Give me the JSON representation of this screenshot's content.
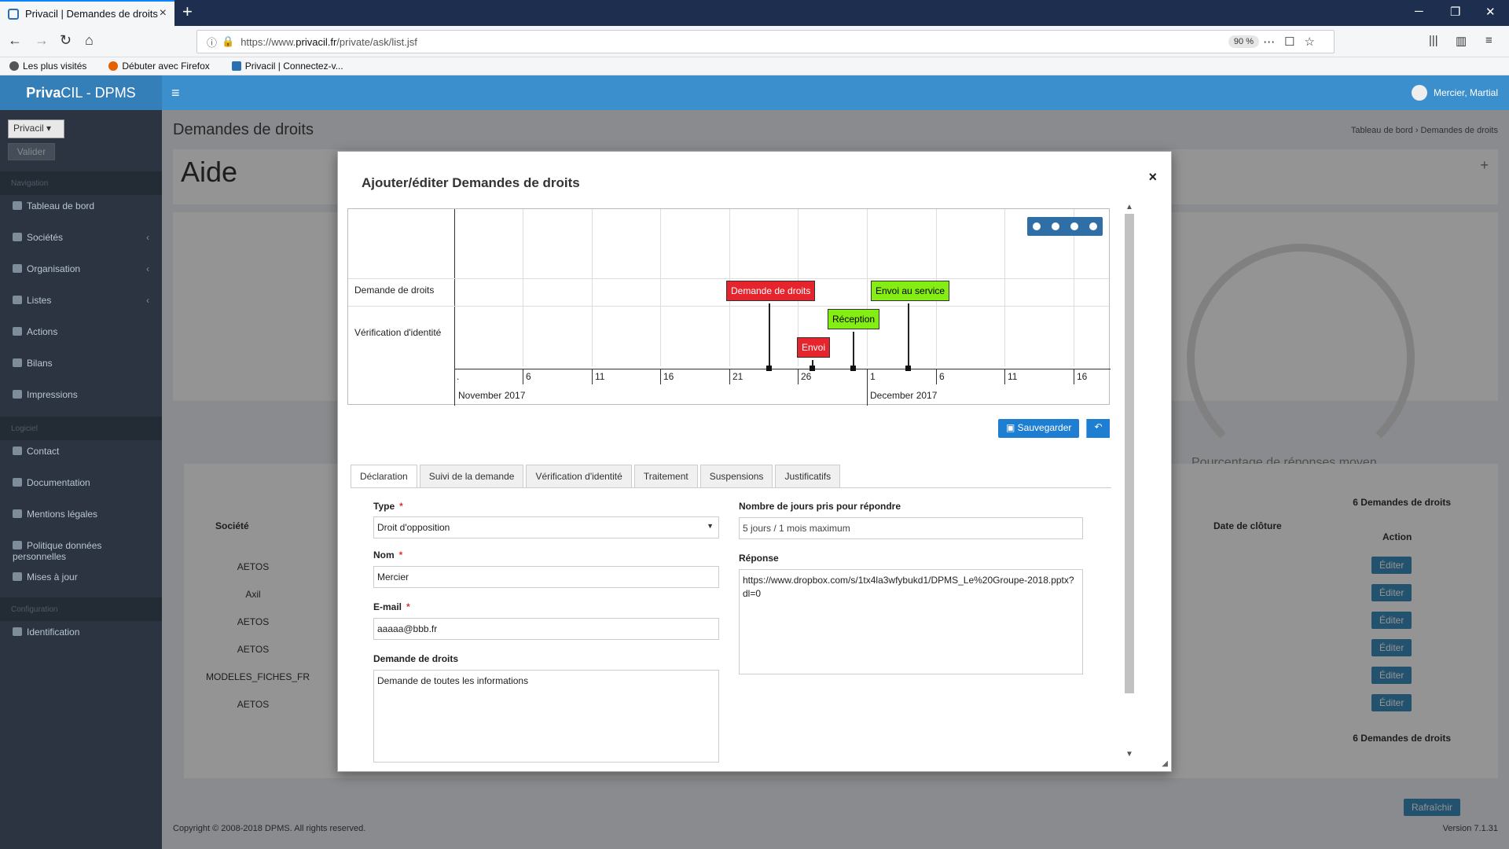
{
  "browser": {
    "tab_title": "Privacil | Demandes de droits",
    "url_prefix": "https://www.",
    "url_domain": "privacil.fr",
    "url_path": "/private/ask/list.jsf",
    "zoom": "90 %",
    "bookmarks": [
      "Les plus visités",
      "Débuter avec Firefox",
      "Privacil | Connectez-v..."
    ]
  },
  "app": {
    "brand_bold": "Priva",
    "brand_rest": "CIL - DPMS",
    "user_name": "Mercier, Martial"
  },
  "sidebar": {
    "select_value": "Privacil",
    "validate_label": "Valider",
    "heading_navigation": "Navigation",
    "heading_logiciel": "Logiciel",
    "heading_configuration": "Configuration",
    "items": [
      {
        "label": "Tableau de bord"
      },
      {
        "label": "Sociétés"
      },
      {
        "label": "Organisation"
      },
      {
        "label": "Listes"
      },
      {
        "label": "Actions"
      },
      {
        "label": "Bilans"
      },
      {
        "label": "Impressions"
      },
      {
        "label": "Contact"
      },
      {
        "label": "Documentation"
      },
      {
        "label": "Mentions légales"
      },
      {
        "label": "Politique données personnelles"
      },
      {
        "label": "Mises à jour"
      },
      {
        "label": "Identification"
      }
    ]
  },
  "page": {
    "title": "Demandes de droits",
    "crumb": "Tableau de bord  ›  Demandes de droits",
    "aide": "Aide",
    "gauge_label": "Pourcentage de réponses moyen",
    "refresh_label": "Rafraîchir",
    "count_label": "6 Demandes de droits",
    "col_societe": "Société",
    "col_cloture": "Date de clôture",
    "col_action": "Action",
    "edit_label": "Éditer",
    "rows": [
      "AETOS",
      "Axil",
      "AETOS",
      "AETOS",
      "MODELES_FICHES_FR",
      "AETOS"
    ],
    "footer": "Copyright © 2008-2018 DPMS. All rights reserved.",
    "version": "Version 7.1.31"
  },
  "modal": {
    "title": "Ajouter/éditer Demandes de droits",
    "close": "×",
    "timeline": {
      "rows": [
        "Demande de droits",
        "Vérification d'identité"
      ],
      "ticks": [
        ".",
        "6",
        "11",
        "16",
        "21",
        "26",
        "1",
        "6",
        "11",
        "16"
      ],
      "months": [
        "November 2017",
        "December 2017"
      ],
      "events": [
        {
          "label": "Demande de droits",
          "color": "#e6242e"
        },
        {
          "label": "Envoi au service",
          "color": "#84ee14"
        },
        {
          "label": "Réception",
          "color": "#84ee14"
        },
        {
          "label": "Envoi",
          "color": "#e6242e"
        }
      ]
    },
    "save_label": "Sauvegarder",
    "back_label": "↶",
    "tabs": [
      "Déclaration",
      "Suivi de la demande",
      "Vérification d'identité",
      "Traitement",
      "Suspensions",
      "Justificatifs"
    ],
    "form": {
      "type_label": "Type",
      "type_value": "Droit d'opposition",
      "nom_label": "Nom",
      "nom_value": "Mercier",
      "email_label": "E-mail",
      "email_value": "aaaaa@bbb.fr",
      "demande_label": "Demande de droits",
      "demande_value": "Demande de toutes les informations",
      "jours_label": "Nombre de jours pris pour répondre",
      "jours_value": "5 jours / 1 mois maximum",
      "reponse_label": "Réponse",
      "reponse_value": "https://www.dropbox.com/s/1tx4la3wfybukd1/DPMS_Le%20Groupe-2018.pptx?dl=0"
    }
  }
}
